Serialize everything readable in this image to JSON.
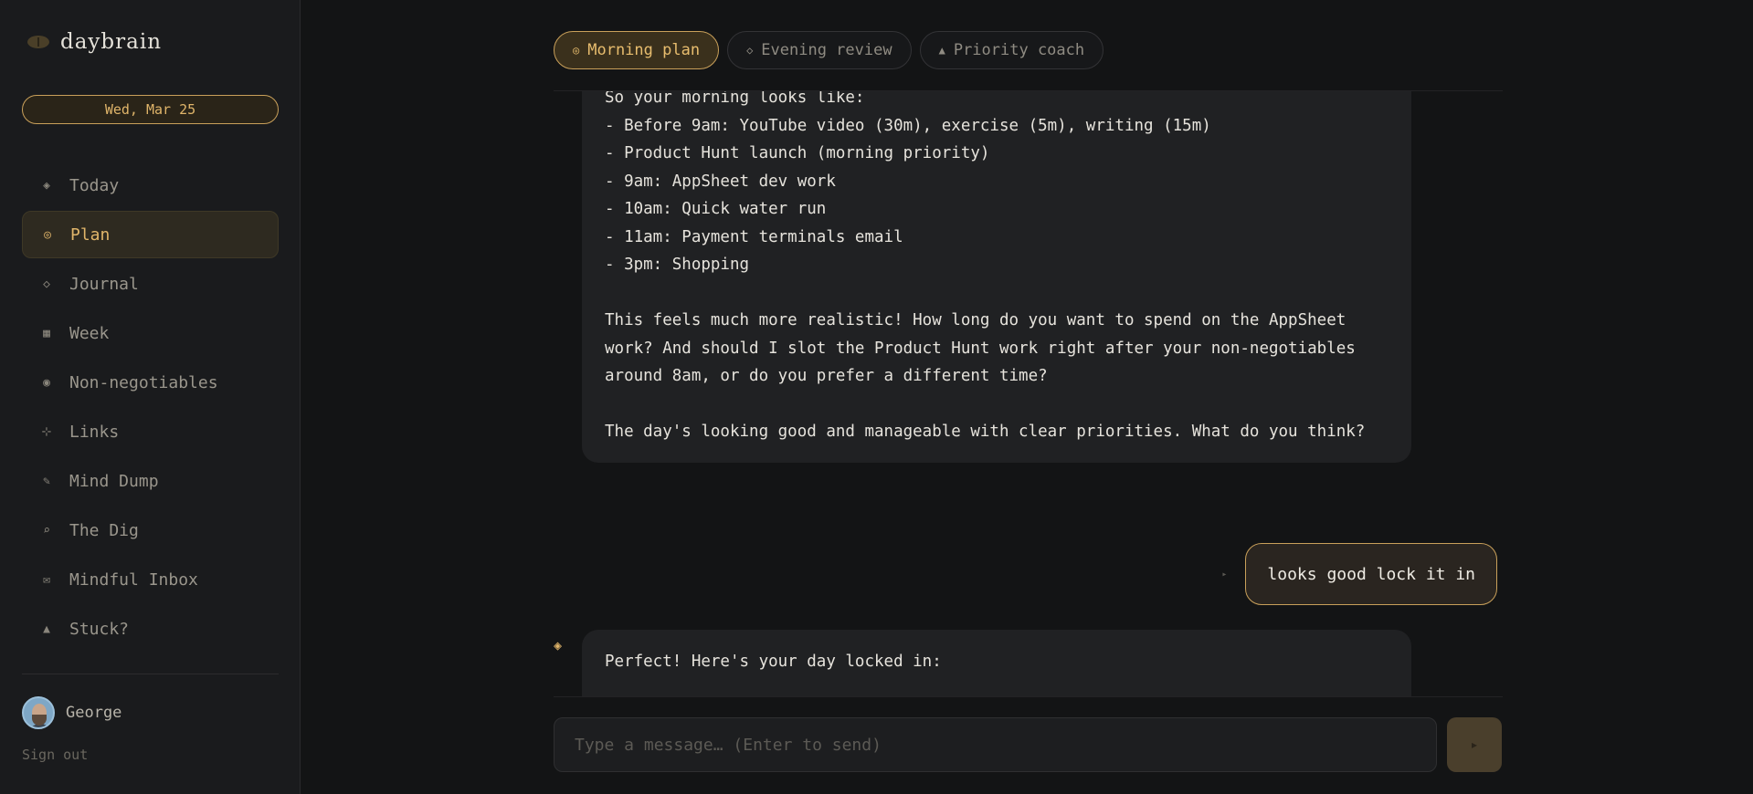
{
  "app": {
    "name": "daybrain"
  },
  "sidebar": {
    "date": "Wed, Mar 25",
    "items": [
      {
        "label": "Today",
        "icon": "◈"
      },
      {
        "label": "Plan",
        "icon": "◎"
      },
      {
        "label": "Journal",
        "icon": "◇"
      },
      {
        "label": "Week",
        "icon": "▦"
      },
      {
        "label": "Non-negotiables",
        "icon": "◉"
      },
      {
        "label": "Links",
        "icon": "⊹"
      },
      {
        "label": "Mind Dump",
        "icon": "✎"
      },
      {
        "label": "The Dig",
        "icon": "⌕"
      },
      {
        "label": "Mindful Inbox",
        "icon": "✉"
      },
      {
        "label": "Stuck?",
        "icon": "▲"
      }
    ],
    "user": {
      "name": "George"
    },
    "signout": "Sign out"
  },
  "tabs": [
    {
      "label": "Morning plan",
      "icon": "◎"
    },
    {
      "label": "Evening review",
      "icon": "◇"
    },
    {
      "label": "Priority coach",
      "icon": "▲"
    }
  ],
  "chat": {
    "messages": [
      {
        "role": "assistant",
        "text": "So your morning looks like:\n- Before 9am: YouTube video (30m), exercise (5m), writing (15m)\n- Product Hunt launch (morning priority)\n- 9am: AppSheet dev work\n- 10am: Quick water run\n- 11am: Payment terminals email\n- 3pm: Shopping\n\nThis feels much more realistic! How long do you want to spend on the AppSheet work? And should I slot the Product Hunt work right after your non-negotiables around 8am, or do you prefer a different time?\n\nThe day's looking good and manageable with clear priorities. What do you think?"
      },
      {
        "role": "user",
        "text": "looks good lock it in",
        "marker": "▸"
      },
      {
        "role": "assistant",
        "marker": "◈",
        "text": "Perfect! Here's your day locked in:"
      }
    ]
  },
  "composer": {
    "placeholder": "Type a message… (Enter to send)",
    "send_icon": "▸"
  },
  "colors": {
    "accent": "#e0b56a",
    "background": "#131415",
    "sidebar": "#1a1b1d",
    "bubble": "#202123"
  }
}
